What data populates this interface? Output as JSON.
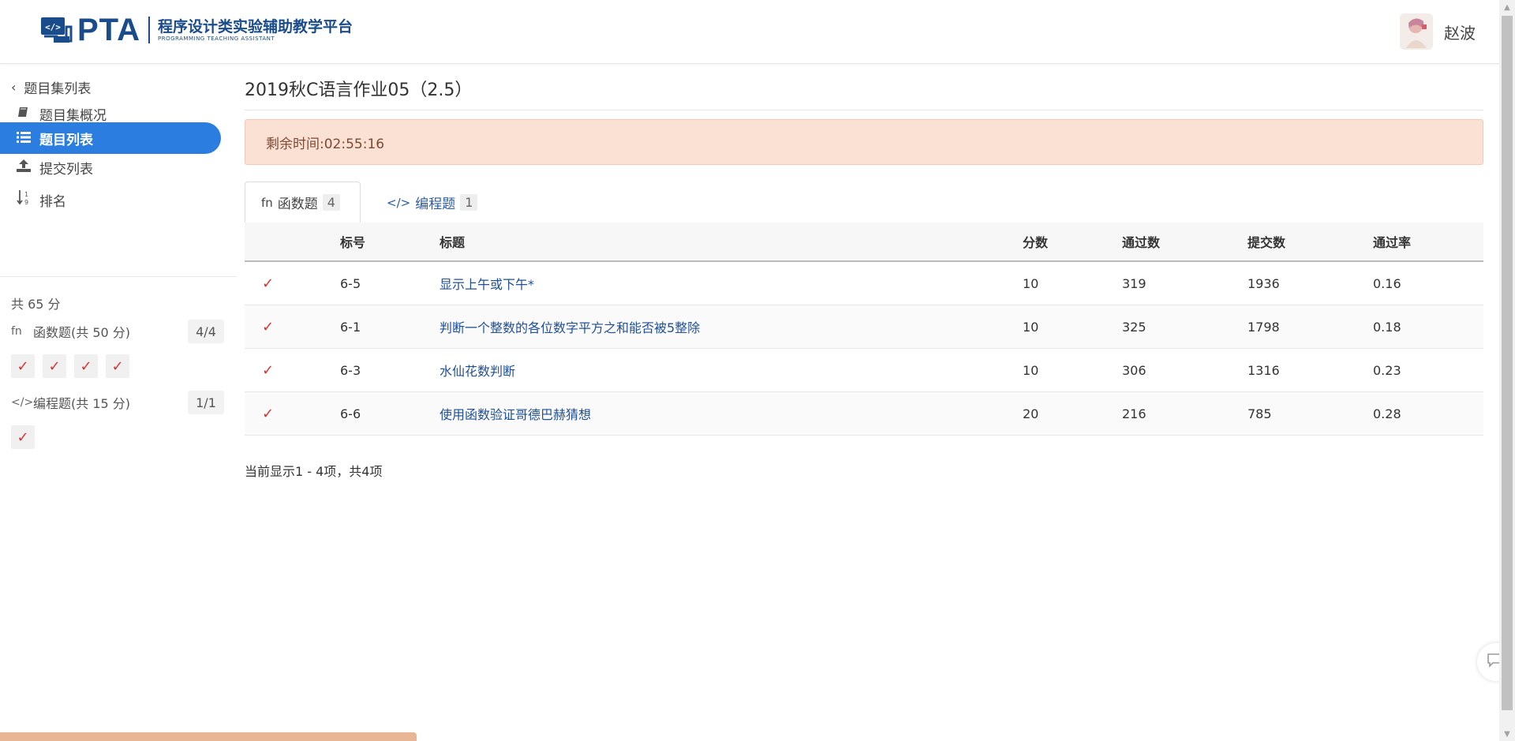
{
  "header": {
    "logo_text": "PTA",
    "logo_cn": "程序设计类实验辅助教学平台",
    "logo_en": "PROGRAMMING TEACHING ASSISTANT",
    "username": "赵波"
  },
  "sidebar": {
    "back_label": "题目集列表",
    "items": [
      {
        "label": "题目集概况",
        "icon": "book-icon"
      },
      {
        "label": "题目列表",
        "icon": "list-icon"
      },
      {
        "label": "提交列表",
        "icon": "upload-icon"
      },
      {
        "label": "排名",
        "icon": "sort-number-icon"
      }
    ],
    "total_score": "共 65 分",
    "groups": [
      {
        "icon": "fn",
        "label": "函数题(共 50 分)",
        "count": "4/4"
      },
      {
        "icon": "</>",
        "label": "编程题(共 15 分)",
        "count": "1/1"
      }
    ],
    "check_mark": "✓"
  },
  "main": {
    "title": "2019秋C语言作业05（2.5）",
    "alert": "剩余时间:02:55:16",
    "tabs": [
      {
        "icon": "fn",
        "label": "函数题",
        "count": "4"
      },
      {
        "icon": "</>",
        "label": "编程题",
        "count": "1"
      }
    ],
    "table": {
      "headers": [
        "标号",
        "标题",
        "分数",
        "通过数",
        "提交数",
        "通过率"
      ],
      "rows": [
        {
          "num": "6-5",
          "title": "显示上午或下午*",
          "score": "10",
          "pass": "319",
          "submit": "1936",
          "rate": "0.16"
        },
        {
          "num": "6-1",
          "title": "判断一个整数的各位数字平方之和能否被5整除",
          "score": "10",
          "pass": "325",
          "submit": "1798",
          "rate": "0.18"
        },
        {
          "num": "6-3",
          "title": "水仙花数判断",
          "score": "10",
          "pass": "306",
          "submit": "1316",
          "rate": "0.23"
        },
        {
          "num": "6-6",
          "title": "使用函数验证哥德巴赫猜想",
          "score": "20",
          "pass": "216",
          "submit": "785",
          "rate": "0.28"
        }
      ]
    },
    "footer_note": "当前显示1 - 4项，共4项"
  },
  "colors": {
    "accent": "#2b7de0",
    "brand": "#1a4c8b",
    "check": "#e03030",
    "alert_bg": "#fbe0d4",
    "link": "#1f4f96"
  }
}
